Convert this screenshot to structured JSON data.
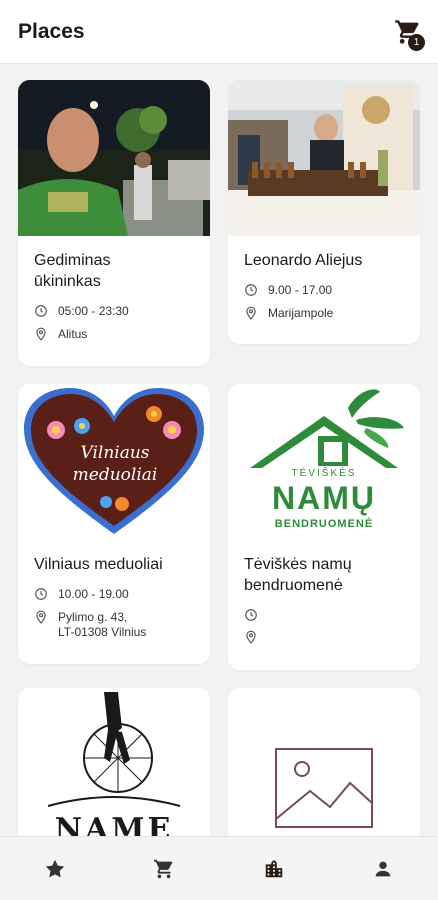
{
  "header": {
    "title": "Places",
    "cart_icon": "cart-icon",
    "cart_count": "1"
  },
  "places": [
    {
      "name": "Gediminas\nūkininkas",
      "hours": "05:00 - 23:30",
      "address": "Alitus"
    },
    {
      "name": "Leonardo Aliejus",
      "hours": "9.00 - 17.00",
      "address": "Marijampole"
    },
    {
      "name": "Vilniaus meduoliai",
      "hours": "10.00 - 19.00",
      "address": "Pylimo g. 43,\nLT-01308 Vilnius",
      "logo_text": "Vilniaus\nmeduoliai"
    },
    {
      "name": "Tėviškės namų\nbendruomenė",
      "hours": "",
      "address": "",
      "logo_top": "TĖVIŠKĖS",
      "logo_main": "NAMŲ",
      "logo_bottom": "BENDRUOMENĖ"
    },
    {
      "name": "",
      "hours": "",
      "address": "",
      "logo_text": "NAME"
    },
    {
      "name": "",
      "hours": "",
      "address": "",
      "image": "image-placeholder-icon"
    }
  ],
  "bottom_nav": {
    "items": [
      {
        "icon": "star-icon"
      },
      {
        "icon": "cart-icon"
      },
      {
        "icon": "city-icon",
        "active": true
      },
      {
        "icon": "person-icon"
      }
    ]
  },
  "colors": {
    "accent": "#2a1c14",
    "green": "#2e8b3a",
    "heart_red": "#c0392b"
  }
}
